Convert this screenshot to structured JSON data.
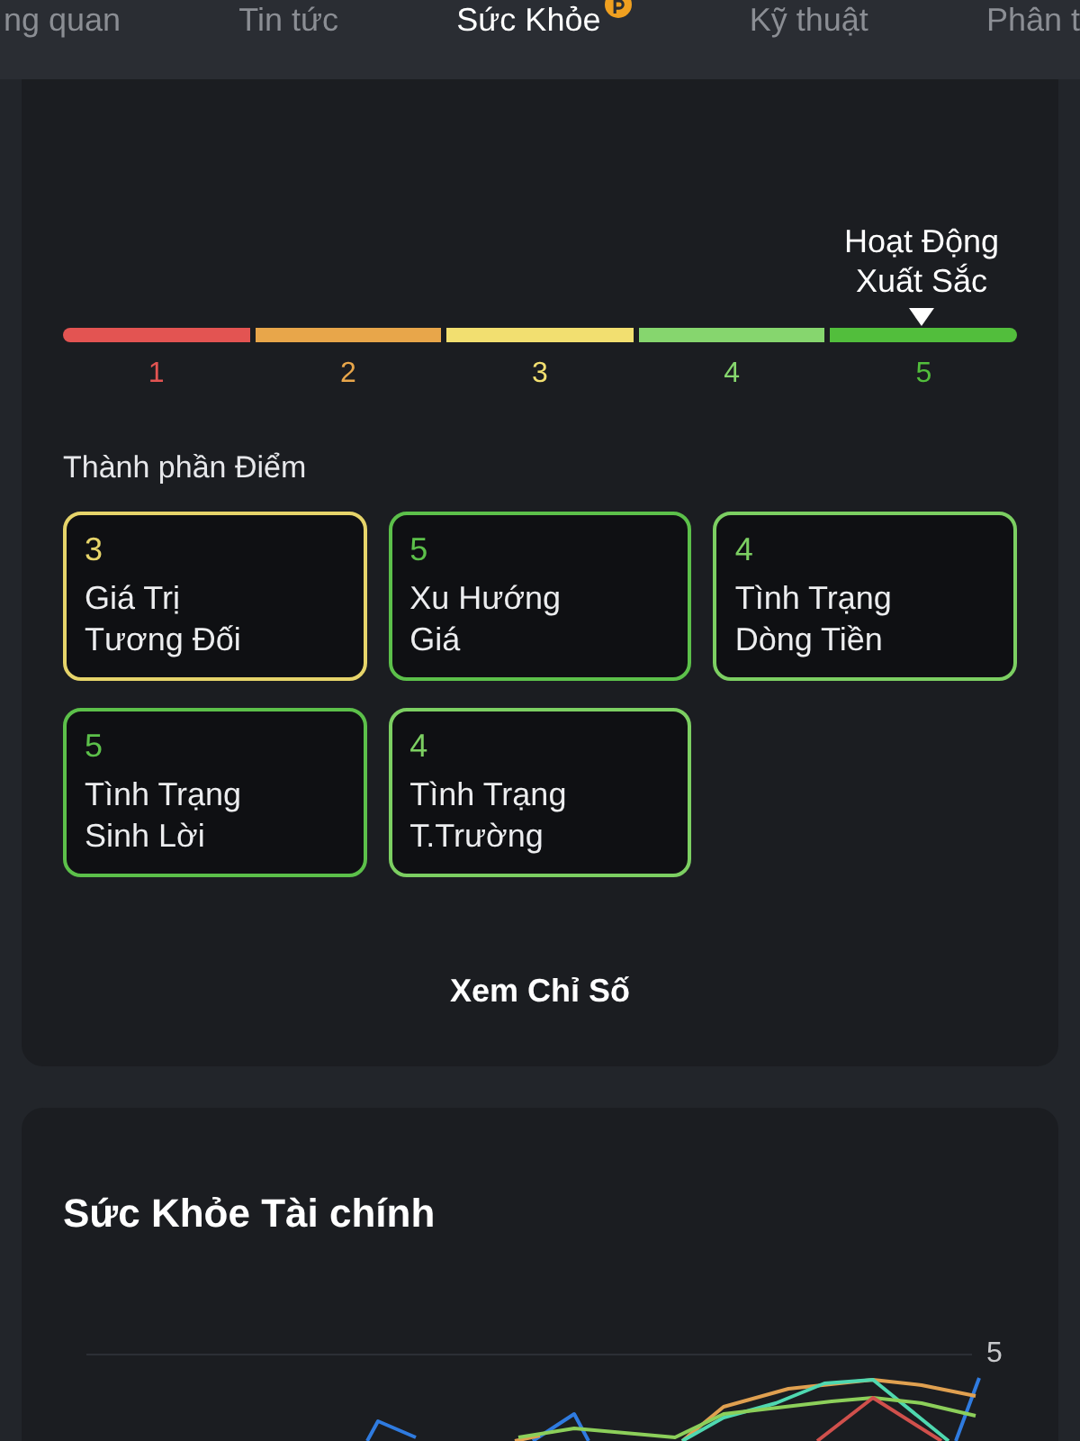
{
  "tabs": [
    {
      "label": "ng quan",
      "selected": false,
      "badge": false
    },
    {
      "label": "Tin tức",
      "selected": false,
      "badge": false
    },
    {
      "label": "Sức Khỏe",
      "selected": true,
      "badge": true
    },
    {
      "label": "Kỹ thuật",
      "selected": false,
      "badge": false
    },
    {
      "label": "Phân t",
      "selected": false,
      "badge": false
    }
  ],
  "score_card": {
    "rating_label": "Hoạt Động\nXuất Sắc",
    "level": 0.9,
    "scale": [
      {
        "number": "1",
        "color": "#e35452"
      },
      {
        "number": "2",
        "color": "#e8a64a"
      },
      {
        "number": "3",
        "color": "#f2df70"
      },
      {
        "number": "4",
        "color": "#86d66e"
      },
      {
        "number": "5",
        "color": "#52be3c"
      }
    ],
    "components_title": "Thành phần Điểm",
    "components": [
      {
        "score": "3",
        "label": "Giá Trị\nTương Đối",
        "color": "#e6d46a"
      },
      {
        "score": "5",
        "label": "Xu Hướng\nGiá",
        "color": "#5cc04a"
      },
      {
        "score": "4",
        "label": "Tình Trạng\nDòng Tiền",
        "color": "#7ccf62"
      },
      {
        "score": "5",
        "label": "Tình Trạng\nSinh Lời",
        "color": "#5cc04a"
      },
      {
        "score": "4",
        "label": "Tình Trạng\nT.Trường",
        "color": "#7ccf62"
      }
    ],
    "button": "Xem Chỉ Số"
  },
  "trend_card": {
    "title": "Sức Khỏe Tài chính",
    "axis_label": "5"
  }
}
